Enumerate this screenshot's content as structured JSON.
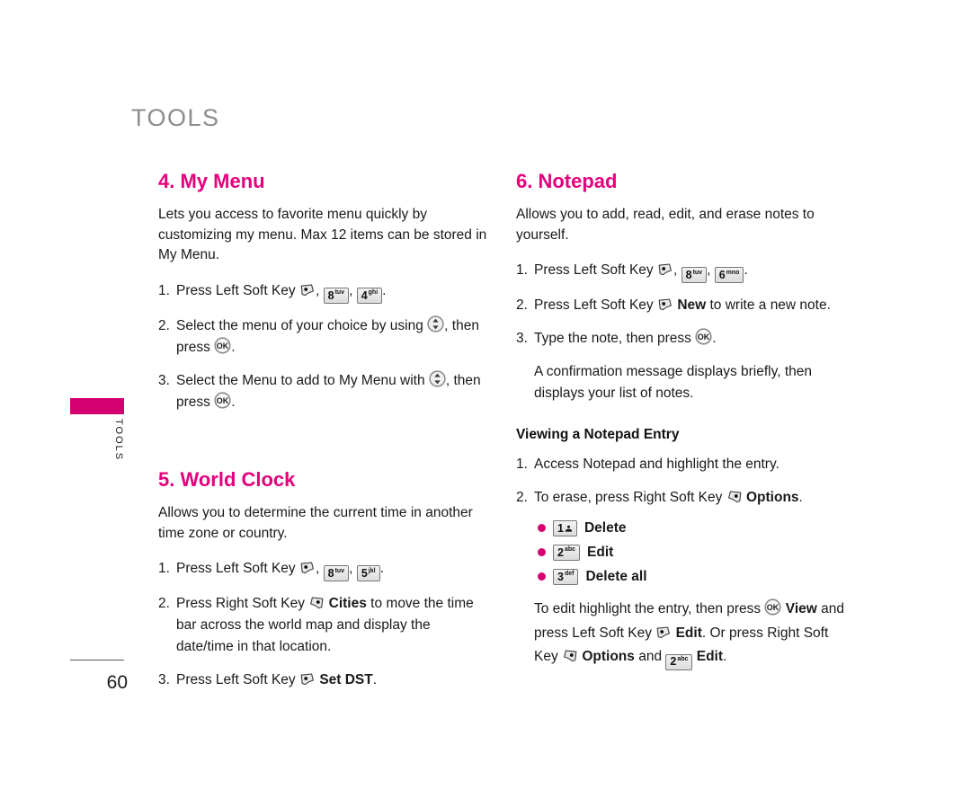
{
  "page": {
    "chapter_title": "TOOLS",
    "side_tab_label": "TOOLS",
    "page_number": "60"
  },
  "icons": {
    "left_soft_key": "left-soft-key-icon",
    "right_soft_key": "right-soft-key-icon",
    "ok_key": "ok-key-icon",
    "nav_updown": "navigation-up-down-icon",
    "key_1": "key-1-voicemail",
    "key_2": "key-2-abc",
    "key_3": "key-3-def",
    "key_4": "key-4-ghi",
    "key_5": "key-5-jkl",
    "key_6": "key-6-mno",
    "key_8": "key-8-tuv"
  },
  "keys": {
    "k1": {
      "digit": "1",
      "sub": ""
    },
    "k2": {
      "digit": "2",
      "sub": "abc"
    },
    "k3": {
      "digit": "3",
      "sub": "def"
    },
    "k4": {
      "digit": "4",
      "sub": "ghi"
    },
    "k5": {
      "digit": "5",
      "sub": "jkl"
    },
    "k6": {
      "digit": "6",
      "sub": "mno"
    },
    "k8": {
      "digit": "8",
      "sub": "tuv"
    }
  },
  "colors": {
    "accent": "#e5007d",
    "tab": "#d4006f",
    "chapter": "#8c8c8c"
  },
  "sections": {
    "my_menu": {
      "heading": "4. My Menu",
      "intro": "Lets you access to favorite menu quickly by customizing my menu. Max 12 items can be stored in My Menu.",
      "step1_num": "1.",
      "step1_a": "Press Left Soft Key",
      "step1_comma1": ",",
      "step1_comma2": ",",
      "step1_end": ".",
      "step2_num": "2.",
      "step2_a": "Select the menu of your choice by using",
      "step2_b": ", then press",
      "step2_end": ".",
      "step3_num": "3.",
      "step3_a": "Select the Menu to add to My Menu with",
      "step3_b": ", then press",
      "step3_end": "."
    },
    "world_clock": {
      "heading": "5. World Clock",
      "intro": "Allows you to determine the current time in another time zone or country.",
      "step1_num": "1.",
      "step1_a": "Press Left Soft Key",
      "step1_comma1": ",",
      "step1_comma2": ",",
      "step1_end": ".",
      "step2_num": "2.",
      "step2_a": "Press Right Soft Key",
      "step2_bold": "Cities",
      "step2_b": "to move the time bar across the world map and display the date/time in that location.",
      "step3_num": "3.",
      "step3_a": "Press Left Soft Key",
      "step3_bold": "Set DST",
      "step3_end": "."
    },
    "notepad": {
      "heading": "6. Notepad",
      "intro": "Allows you to add, read, edit, and erase notes to yourself.",
      "step1_num": "1.",
      "step1_a": "Press Left Soft Key",
      "step1_comma1": ",",
      "step1_comma2": ",",
      "step1_end": ".",
      "step2_num": "2.",
      "step2_a": "Press Left Soft Key",
      "step2_bold": "New",
      "step2_b": "to write a new note.",
      "step3_num": "3.",
      "step3_a": "Type the note, then press",
      "step3_end": ".",
      "note": "A confirmation message displays briefly, then displays your list of notes.",
      "sub_heading": "Viewing a Notepad Entry",
      "v1_num": "1.",
      "v1_text": "Access Notepad and highlight the entry.",
      "v2_num": "2.",
      "v2_a": "To erase, press Right Soft Key",
      "v2_bold": "Options",
      "v2_end": ".",
      "bullets": [
        {
          "label": "Delete"
        },
        {
          "label": "Edit"
        },
        {
          "label": "Delete all"
        }
      ],
      "tail_a": "To edit highlight the entry, then press",
      "tail_bold1": "View",
      "tail_b": "and press Left Soft Key",
      "tail_bold2": "Edit",
      "tail_c": ". Or press Right Soft Key",
      "tail_bold3": "Options",
      "tail_d": "and",
      "tail_bold4": "Edit",
      "tail_end": "."
    }
  }
}
